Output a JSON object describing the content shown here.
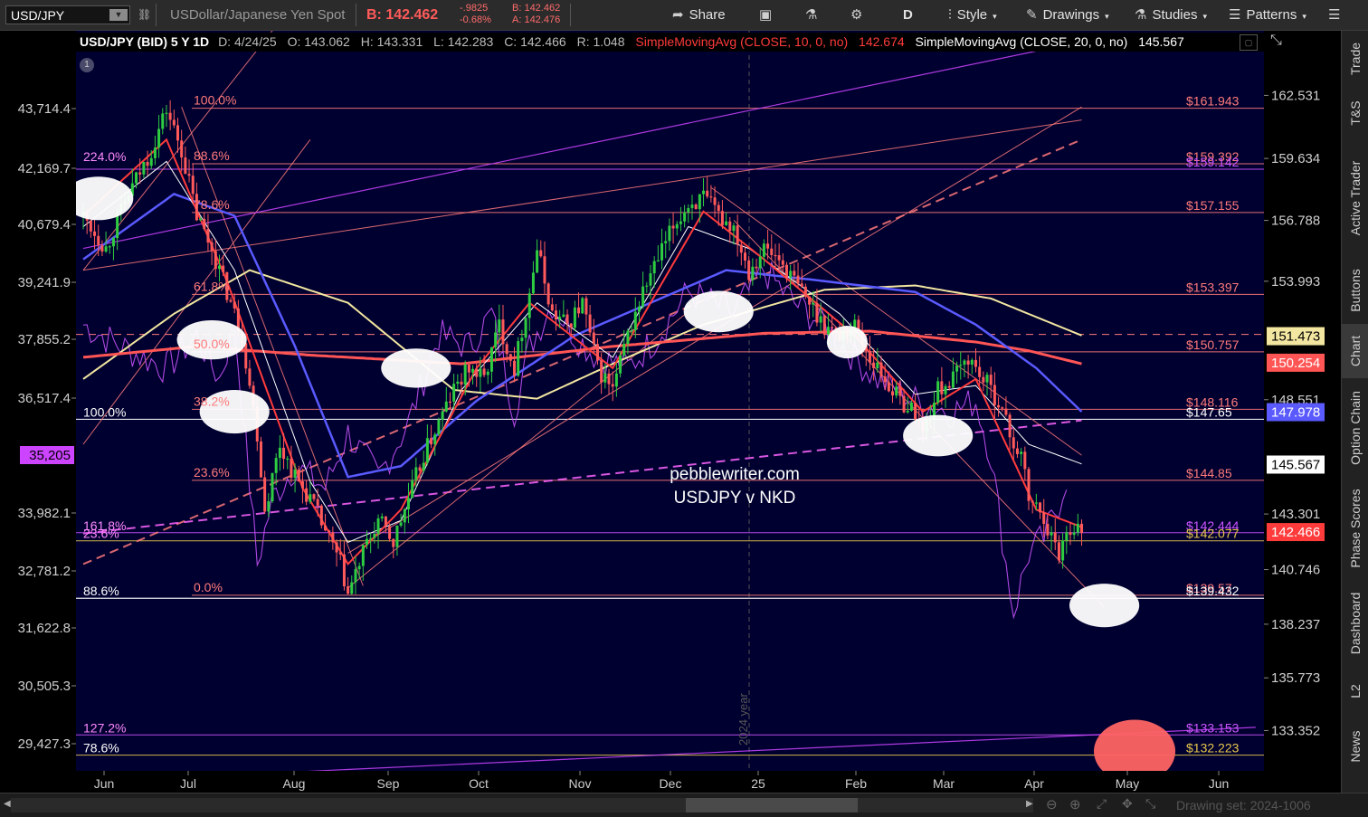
{
  "toolbar": {
    "symbol": "USD/JPY",
    "description": "USDollar/Japanese Yen Spot",
    "bid_label": "B: 142.462",
    "change": "-.9825",
    "change_pct": "-0.68%",
    "bid_small": "B: 142.462",
    "ask_small": "A: 142.476",
    "share": "Share",
    "period": "D",
    "style": "Style",
    "drawings": "Drawings",
    "studies": "Studies",
    "patterns": "Patterns"
  },
  "header": {
    "title": "USD/JPY (BID) 5 Y 1D",
    "date": "D: 4/24/25",
    "open": "O: 143.062",
    "high": "H: 143.331",
    "low": "L: 142.283",
    "close": "C: 142.466",
    "range": "R: 1.048",
    "sma10": "SimpleMovingAvg (CLOSE, 10, 0, no)",
    "sma10_val": "142.674",
    "sma20": "SimpleMovingAvg (CLOSE, 20, 0, no)",
    "sma20_val": "145.567"
  },
  "watermark": [
    "pebblewriter.com",
    "USDJPY v NKD"
  ],
  "year_label": "2024 year",
  "sidebar": [
    "Trade",
    "T&S",
    "Active Trader",
    "Buttons",
    "Chart",
    "Option Chain",
    "Phase Scores",
    "Dashboard",
    "L2",
    "News"
  ],
  "sidebar_active": "Chart",
  "bottom": {
    "drawing_set": "Drawing set: 2024-1006"
  },
  "colors": {
    "background": "#000030",
    "up": "#2ecc40",
    "down": "#ff5a5a",
    "sma10": "#ff3b3b",
    "sma20": "#ffffff",
    "ma50": "#5a5aff",
    "ma200": "#f2e6a0",
    "ma_red": "#ff5555",
    "nkd": "#cc55ff",
    "fib": "#ff7f7f",
    "purple_line": "#cc44ff"
  },
  "chart_data": {
    "type": "candlestick",
    "title": "USD/JPY (BID) 5 Y 1D",
    "x_ticks": [
      "Jun",
      "Jul",
      "Aug",
      "Sep",
      "Oct",
      "Nov",
      "Dec",
      "25",
      "Feb",
      "Mar",
      "Apr",
      "May",
      "Jun"
    ],
    "right_axis": {
      "label": "USD/JPY",
      "ticks": [
        162.531,
        159.634,
        156.788,
        153.993,
        148.551,
        143.301,
        140.746,
        138.237,
        135.773,
        133.352
      ],
      "ylim": [
        131.5,
        165.5
      ]
    },
    "left_axis": {
      "label": "NKD",
      "ticks": [
        "43,714.4",
        "42,169.7",
        "40,679.4",
        "39,241.9",
        "37,855.2",
        "36,517.4",
        "33,982.1",
        "32,781.2",
        "31,622.8",
        "30,505.3",
        "29,427.3"
      ],
      "highlight": "35,205"
    },
    "last_price": 142.466,
    "price_markers": [
      {
        "label": "151.473",
        "value": 151.47,
        "color": "#f2e6a0"
      },
      {
        "label": "150.254",
        "value": 150.25,
        "color": "#ff5555"
      },
      {
        "label": "147.978",
        "value": 147.98,
        "color": "#5a5aff"
      },
      {
        "label": "145.567",
        "value": 145.57,
        "color": "#ffffff"
      },
      {
        "label": "142.466",
        "value": 142.47,
        "color": "#ff3b3b"
      }
    ],
    "fib_left": [
      {
        "label": "100.0%",
        "value": 161.94
      },
      {
        "label": "88.6%",
        "value": 159.4
      },
      {
        "label": "78.6%",
        "value": 157.15
      },
      {
        "label": "61.8%",
        "value": 153.39
      },
      {
        "label": "50.0%",
        "value": 150.75
      },
      {
        "label": "38.2%",
        "value": 148.11
      },
      {
        "label": "23.6%",
        "value": 144.85
      },
      {
        "label": "0.0%",
        "value": 139.57
      }
    ],
    "levels_right": [
      {
        "label": "$161.943",
        "value": 161.94
      },
      {
        "label": "$159.392",
        "value": 159.39
      },
      {
        "label": "$159.142",
        "value": 159.14
      },
      {
        "label": "$157.155",
        "value": 157.15
      },
      {
        "label": "$153.397",
        "value": 153.39
      },
      {
        "label": "$150.757",
        "value": 150.75
      },
      {
        "label": "$148.116",
        "value": 148.11
      },
      {
        "label": "$147.65",
        "value": 147.65
      },
      {
        "label": "$144.85",
        "value": 144.85
      },
      {
        "label": "$142.444",
        "value": 142.44
      },
      {
        "label": "$142.077",
        "value": 142.07
      },
      {
        "label": "$139.57",
        "value": 139.57
      },
      {
        "label": "$139.432",
        "value": 139.43
      },
      {
        "label": "$133.153",
        "value": 133.15
      },
      {
        "label": "$132.223",
        "value": 132.22
      }
    ],
    "left_labels": [
      {
        "label": "224.0%",
        "value": 159.4
      },
      {
        "label": "100.0%",
        "value": 147.65
      },
      {
        "label": "161.8%",
        "value": 142.44
      },
      {
        "label": "23.6%",
        "value": 142.07
      },
      {
        "label": "88.6%",
        "value": 139.43
      },
      {
        "label": "127.2%",
        "value": 133.15
      },
      {
        "label": "78.6%",
        "value": 132.22
      }
    ],
    "key_points": [
      [
        0,
        157.0
      ],
      [
        6,
        155.5
      ],
      [
        12,
        158.0
      ],
      [
        18,
        160.0
      ],
      [
        22,
        161.9
      ],
      [
        26,
        160.0
      ],
      [
        30,
        157.0
      ],
      [
        34,
        155.5
      ],
      [
        38,
        153.5
      ],
      [
        42,
        151.5
      ],
      [
        46,
        147.0
      ],
      [
        48,
        143.5
      ],
      [
        52,
        146.5
      ],
      [
        56,
        145.0
      ],
      [
        60,
        144.0
      ],
      [
        64,
        142.5
      ],
      [
        68,
        141.0
      ],
      [
        70,
        139.6
      ],
      [
        74,
        141.5
      ],
      [
        78,
        143.0
      ],
      [
        82,
        142.0
      ],
      [
        86,
        144.0
      ],
      [
        90,
        146.0
      ],
      [
        94,
        147.5
      ],
      [
        98,
        149.0
      ],
      [
        102,
        150.0
      ],
      [
        106,
        149.5
      ],
      [
        110,
        152.0
      ],
      [
        114,
        150.0
      ],
      [
        118,
        153.5
      ],
      [
        120,
        155.5
      ],
      [
        124,
        152.5
      ],
      [
        128,
        152.0
      ],
      [
        132,
        153.0
      ],
      [
        136,
        150.0
      ],
      [
        140,
        149.0
      ],
      [
        144,
        151.5
      ],
      [
        148,
        153.5
      ],
      [
        152,
        155.0
      ],
      [
        156,
        156.5
      ],
      [
        160,
        157.5
      ],
      [
        164,
        157.8
      ],
      [
        168,
        157.0
      ],
      [
        172,
        156.5
      ],
      [
        176,
        154.5
      ],
      [
        180,
        155.5
      ],
      [
        184,
        155.0
      ],
      [
        188,
        154.0
      ],
      [
        192,
        153.0
      ],
      [
        196,
        152.0
      ],
      [
        200,
        151.5
      ],
      [
        204,
        152.0
      ],
      [
        208,
        150.5
      ],
      [
        212,
        149.5
      ],
      [
        216,
        148.5
      ],
      [
        220,
        148.0
      ],
      [
        222,
        147.0
      ],
      [
        226,
        149.0
      ],
      [
        230,
        149.5
      ],
      [
        234,
        150.5
      ],
      [
        238,
        149.5
      ],
      [
        242,
        148.5
      ],
      [
        246,
        146.5
      ],
      [
        248,
        146.0
      ],
      [
        250,
        144.0
      ],
      [
        254,
        143.2
      ],
      [
        256,
        142.2
      ],
      [
        258,
        141.5
      ],
      [
        260,
        142.5
      ],
      [
        262,
        142.8
      ],
      [
        264,
        142.5
      ]
    ],
    "ma20": [
      [
        0,
        156.5
      ],
      [
        22,
        159.5
      ],
      [
        40,
        154.5
      ],
      [
        60,
        144.8
      ],
      [
        70,
        142.0
      ],
      [
        84,
        143.0
      ],
      [
        100,
        149.0
      ],
      [
        120,
        153.0
      ],
      [
        140,
        150.5
      ],
      [
        160,
        156.5
      ],
      [
        176,
        155.5
      ],
      [
        200,
        152.5
      ],
      [
        220,
        148.8
      ],
      [
        236,
        149.2
      ],
      [
        250,
        146.5
      ],
      [
        264,
        145.6
      ]
    ],
    "ma10": [
      [
        0,
        157.0
      ],
      [
        22,
        160.5
      ],
      [
        38,
        154.0
      ],
      [
        58,
        144.5
      ],
      [
        70,
        141.0
      ],
      [
        84,
        143.5
      ],
      [
        104,
        150.0
      ],
      [
        118,
        153.0
      ],
      [
        140,
        150.0
      ],
      [
        164,
        157.2
      ],
      [
        180,
        155.0
      ],
      [
        204,
        151.5
      ],
      [
        222,
        148.0
      ],
      [
        236,
        149.5
      ],
      [
        252,
        143.5
      ],
      [
        264,
        142.7
      ]
    ],
    "ma50": [
      [
        0,
        155.0
      ],
      [
        24,
        158.0
      ],
      [
        40,
        157.0
      ],
      [
        56,
        151.0
      ],
      [
        70,
        145.0
      ],
      [
        84,
        145.5
      ],
      [
        104,
        148.5
      ],
      [
        130,
        151.5
      ],
      [
        150,
        153.0
      ],
      [
        170,
        154.5
      ],
      [
        196,
        154.0
      ],
      [
        220,
        153.5
      ],
      [
        236,
        152.0
      ],
      [
        252,
        150.0
      ],
      [
        264,
        148.0
      ]
    ],
    "ma_red": [
      [
        0,
        150.5
      ],
      [
        30,
        151.0
      ],
      [
        60,
        150.6
      ],
      [
        100,
        150.2
      ],
      [
        140,
        151.0
      ],
      [
        180,
        151.6
      ],
      [
        208,
        151.7
      ],
      [
        236,
        151.2
      ],
      [
        250,
        150.8
      ],
      [
        264,
        150.2
      ]
    ],
    "ma200": [
      [
        0,
        149.5
      ],
      [
        24,
        152.5
      ],
      [
        44,
        154.5
      ],
      [
        70,
        153.0
      ],
      [
        98,
        149.0
      ],
      [
        120,
        148.6
      ],
      [
        140,
        150.2
      ],
      [
        164,
        152.0
      ],
      [
        196,
        153.6
      ],
      [
        220,
        153.8
      ],
      [
        240,
        153.2
      ],
      [
        264,
        151.5
      ]
    ],
    "nkd": [
      [
        0,
        152.0
      ],
      [
        10,
        151.0
      ],
      [
        22,
        150.0
      ],
      [
        30,
        151.5
      ],
      [
        36,
        149.5
      ],
      [
        40,
        152.0
      ],
      [
        46,
        141.0
      ],
      [
        50,
        144.0
      ],
      [
        56,
        145.5
      ],
      [
        64,
        144.5
      ],
      [
        70,
        147.0
      ],
      [
        78,
        145.0
      ],
      [
        86,
        147.5
      ],
      [
        94,
        151.5
      ],
      [
        102,
        151.0
      ],
      [
        108,
        152.5
      ],
      [
        114,
        148.0
      ],
      [
        118,
        151.0
      ],
      [
        124,
        153.0
      ],
      [
        130,
        151.5
      ],
      [
        136,
        150.5
      ],
      [
        144,
        150.0
      ],
      [
        152,
        151.5
      ],
      [
        160,
        153.5
      ],
      [
        166,
        153.0
      ],
      [
        172,
        152.5
      ],
      [
        180,
        154.5
      ],
      [
        188,
        153.0
      ],
      [
        196,
        152.0
      ],
      [
        204,
        150.5
      ],
      [
        210,
        149.5
      ],
      [
        220,
        148.5
      ],
      [
        230,
        148.0
      ],
      [
        236,
        148.5
      ],
      [
        240,
        146.0
      ],
      [
        244,
        141.0
      ],
      [
        246,
        138.8
      ],
      [
        250,
        141.5
      ],
      [
        254,
        142.2
      ],
      [
        258,
        143.8
      ],
      [
        260,
        145.0
      ]
    ],
    "ellipses": [
      {
        "x": 4,
        "y": 157.8,
        "rx": 12,
        "ry": 1.0,
        "color": "#ffffff"
      },
      {
        "x": 34,
        "y": 151.3,
        "rx": 12,
        "ry": 0.9,
        "color": "#ffffff"
      },
      {
        "x": 40,
        "y": 148.0,
        "rx": 12,
        "ry": 1.0,
        "color": "#ffffff"
      },
      {
        "x": 88,
        "y": 150.0,
        "rx": 12,
        "ry": 0.9,
        "color": "#ffffff"
      },
      {
        "x": 168,
        "y": 152.6,
        "rx": 12,
        "ry": 0.95,
        "color": "#ffffff"
      },
      {
        "x": 202,
        "y": 151.2,
        "rx": 7,
        "ry": 0.75,
        "color": "#ffffff"
      },
      {
        "x": 226,
        "y": 146.9,
        "rx": 12,
        "ry": 0.95,
        "color": "#ffffff"
      },
      {
        "x": 270,
        "y": 139.1,
        "rx": 12,
        "ry": 1.0,
        "color": "#ffffff"
      },
      {
        "x": 278,
        "y": 132.4,
        "rx": 14,
        "ry": 1.45,
        "color": "#ff6464"
      }
    ]
  }
}
